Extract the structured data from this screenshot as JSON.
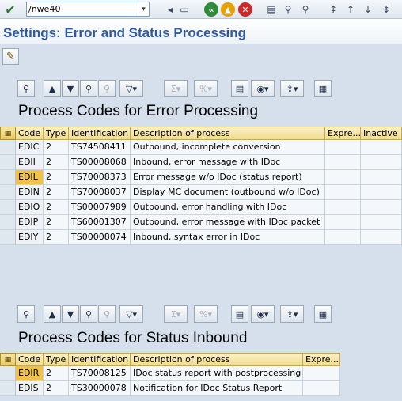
{
  "command_field": {
    "value": "/nwe40"
  },
  "title": "Settings: Error and Status Processing",
  "error_section": {
    "title": "Process Codes for Error Processing",
    "columns": [
      "Code",
      "Type",
      "Identification",
      "Description of process",
      "Expre...",
      "Inactive"
    ],
    "rows": [
      {
        "code": "EDIC",
        "type": "2",
        "identification": "TS74508411",
        "description": "Outbound, incomplete conversion"
      },
      {
        "code": "EDII",
        "type": "2",
        "identification": "TS00008068",
        "description": "Inbound, error message with IDoc"
      },
      {
        "code": "EDIL",
        "type": "2",
        "identification": "TS70008373",
        "description": "Error message w/o IDoc (status report)",
        "focused": true
      },
      {
        "code": "EDIN",
        "type": "2",
        "identification": "TS70008037",
        "description": "Display MC document (outbound w/o IDoc)"
      },
      {
        "code": "EDIO",
        "type": "2",
        "identification": "TS00007989",
        "description": "Outbound, error handling with IDoc"
      },
      {
        "code": "EDIP",
        "type": "2",
        "identification": "TS60001307",
        "description": "Outbound, error message with IDoc packet"
      },
      {
        "code": "EDIY",
        "type": "2",
        "identification": "TS00008074",
        "description": "Inbound, syntax error in IDoc"
      }
    ]
  },
  "status_section": {
    "title": "Process Codes for Status Inbound",
    "columns": [
      "Code",
      "Type",
      "Identification",
      "Description of process",
      "Expre..."
    ],
    "rows": [
      {
        "code": "EDIR",
        "type": "2",
        "identification": "TS70008125",
        "description": "IDoc status report with postprocessing",
        "focused": true
      },
      {
        "code": "EDIS",
        "type": "2",
        "identification": "TS30000078",
        "description": "Notification for IDoc Status Report"
      }
    ]
  },
  "colors": {
    "title": "#2f5aa3",
    "background": "#d5e0ec",
    "header": "#f1dc8c",
    "focus": "#f1c24a"
  }
}
